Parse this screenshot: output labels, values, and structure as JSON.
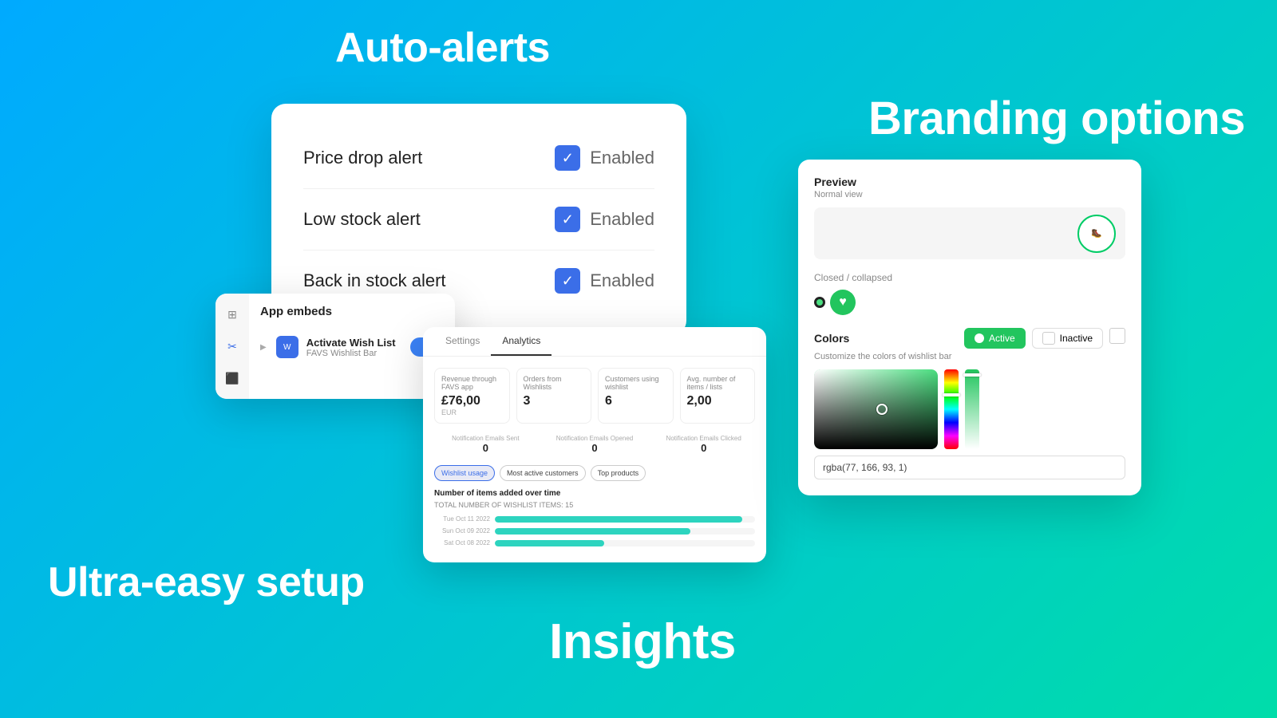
{
  "background": {
    "gradient_start": "#00aaff",
    "gradient_end": "#00ddaa"
  },
  "labels": {
    "auto_alerts": "Auto-alerts",
    "branding_options": "Branding options",
    "ultra_easy_setup": "Ultra-easy setup",
    "insights": "Insights"
  },
  "alerts_card": {
    "alerts": [
      {
        "name": "Price drop alert",
        "status": "Enabled",
        "checked": true
      },
      {
        "name": "Low stock alert",
        "status": "Enabled",
        "checked": true
      },
      {
        "name": "Back in stock alert",
        "status": "Enabled",
        "checked": true
      }
    ]
  },
  "app_embeds": {
    "title": "App embeds",
    "item": {
      "name": "Activate Wish List",
      "sub": "FAVS Wishlist Bar",
      "enabled": true
    }
  },
  "analytics": {
    "tabs": [
      "Settings",
      "Analytics"
    ],
    "active_tab": "Analytics",
    "stats": [
      {
        "label": "Revenue through FAVS app",
        "value": "£76,00",
        "sub": "EUR"
      },
      {
        "label": "Orders from Wishlists",
        "value": "3"
      },
      {
        "label": "Customers using wishlist",
        "value": "6"
      },
      {
        "label": "Avg. number of items / lists",
        "value": "2,00"
      }
    ],
    "notification_stats": [
      {
        "label": "Notification Emails Sent",
        "value": "0"
      },
      {
        "label": "Notification Emails Opened",
        "value": "0"
      },
      {
        "label": "Notification Emails Clicked",
        "value": "0"
      }
    ],
    "chart_title": "Number of items added over time",
    "chart_subtitle": "TOTAL NUMBER OF WISHLIST ITEMS: 15",
    "chart_rows": [
      {
        "date": "Tue Oct 11 2022",
        "pct": 95
      },
      {
        "date": "Sun Oct 09 2022",
        "pct": 75
      },
      {
        "date": "Sat Oct 08 2022",
        "pct": 42
      }
    ],
    "wishlist_tags": [
      "Wishlist usage",
      "Most active customers",
      "Top products"
    ]
  },
  "branding": {
    "preview_label": "Preview",
    "preview_sub": "Normal view",
    "collapsed_label": "Closed / collapsed",
    "colors_title": "Colors",
    "colors_sub": "Customize the colors of wishlist bar",
    "active_toggle": "Active",
    "inactive_toggle": "Inactive",
    "rgba_value": "rgba(77, 166, 93, 1)"
  }
}
